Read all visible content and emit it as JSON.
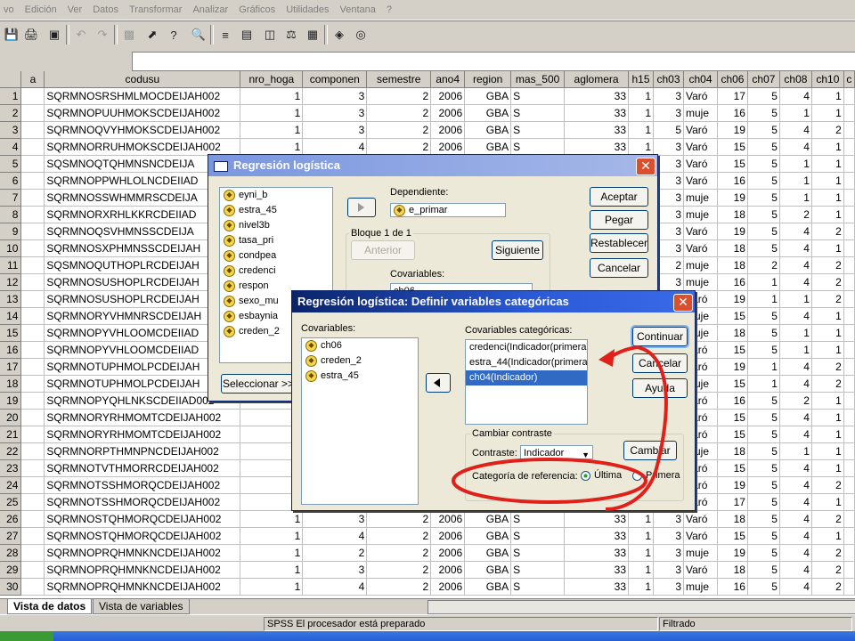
{
  "menu": [
    "vo",
    "Edición",
    "Ver",
    "Datos",
    "Transformar",
    "Analizar",
    "Gráficos",
    "Utilidades",
    "Ventana",
    "?"
  ],
  "toolbar_icons": [
    "save-icon",
    "print-icon",
    "dialog-recall-icon",
    "undo-icon",
    "redo-icon",
    "goto-chart-icon",
    "goto-case-icon",
    "variables-icon",
    "find-icon",
    "insert-cases-icon",
    "insert-variable-icon",
    "split-file-icon",
    "weight-cases-icon",
    "select-cases-icon",
    "value-labels-icon",
    "use-sets-icon"
  ],
  "grid": {
    "columns": [
      "",
      "a",
      "codusu",
      "nro_hoga",
      "componen",
      "semestre",
      "ano4",
      "region",
      "mas_500",
      "aglomera",
      "h15",
      "ch03",
      "ch04",
      "ch06",
      "ch07",
      "ch08",
      "ch10",
      "c"
    ],
    "rows": [
      [
        "1",
        "",
        "SQRMNOSRSHMLMOCDEIJAH002",
        "1",
        "3",
        "2",
        "2006",
        "GBA",
        "S",
        "33",
        "1",
        "3",
        "Varó",
        "17",
        "5",
        "4",
        "1"
      ],
      [
        "2",
        "",
        "SQRMNOPUUHMOKSCDEIJAH002",
        "1",
        "3",
        "2",
        "2006",
        "GBA",
        "S",
        "33",
        "1",
        "3",
        "muje",
        "16",
        "5",
        "1",
        "1"
      ],
      [
        "3",
        "",
        "SQRMNOQVYHMOKSCDEIJAH002",
        "1",
        "3",
        "2",
        "2006",
        "GBA",
        "S",
        "33",
        "1",
        "5",
        "Varó",
        "19",
        "5",
        "4",
        "2"
      ],
      [
        "4",
        "",
        "SQRMNORRUHMOKSCDEIJAH002",
        "1",
        "4",
        "2",
        "2006",
        "GBA",
        "S",
        "33",
        "1",
        "3",
        "Varó",
        "15",
        "5",
        "4",
        "1"
      ],
      [
        "5",
        "",
        "SQSMNOQTQHMNSNCDEIJA",
        "",
        "",
        "",
        "",
        "",
        "",
        "",
        "",
        "3",
        "Varó",
        "15",
        "5",
        "1",
        "1"
      ],
      [
        "6",
        "",
        "SQRMNOPPWHLOLNCDEIIAD",
        "",
        "",
        "",
        "",
        "",
        "",
        "",
        "",
        "3",
        "Varó",
        "16",
        "5",
        "1",
        "1"
      ],
      [
        "7",
        "",
        "SQRMNOSSWHMMRSCDEIJA",
        "",
        "",
        "",
        "",
        "",
        "",
        "",
        "",
        "3",
        "muje",
        "19",
        "5",
        "1",
        "1"
      ],
      [
        "8",
        "",
        "SQRMNORXRHLKKRCDEIIAD",
        "",
        "",
        "",
        "",
        "",
        "",
        "",
        "",
        "3",
        "muje",
        "18",
        "5",
        "2",
        "1"
      ],
      [
        "9",
        "",
        "SQRMNOQSVHMNSSCDEIJA",
        "",
        "",
        "",
        "",
        "",
        "",
        "",
        "",
        "3",
        "Varó",
        "19",
        "5",
        "4",
        "2"
      ],
      [
        "10",
        "",
        "SQRMNOSXPHMNSSCDEIJAH",
        "",
        "",
        "",
        "",
        "",
        "",
        "",
        "",
        "3",
        "Varó",
        "18",
        "5",
        "4",
        "1"
      ],
      [
        "11",
        "",
        "SQSMNOQUTHOPLRCDEIJAH",
        "",
        "",
        "",
        "",
        "",
        "",
        "",
        "",
        "2",
        "muje",
        "18",
        "2",
        "4",
        "2"
      ],
      [
        "12",
        "",
        "SQRMNOSUSHOPLRCDEIJAH",
        "",
        "",
        "",
        "",
        "",
        "",
        "",
        "",
        "3",
        "muje",
        "16",
        "1",
        "4",
        "2"
      ],
      [
        "13",
        "",
        "SQRMNOSUSHOPLRCDEIJAH",
        "",
        "",
        "",
        "",
        "",
        "",
        "",
        "",
        "3",
        "Varó",
        "19",
        "1",
        "1",
        "2"
      ],
      [
        "14",
        "",
        "SQRMNORYVHMNRSCDEIJAH",
        "",
        "",
        "",
        "",
        "",
        "",
        "",
        "",
        "",
        "muje",
        "15",
        "5",
        "4",
        "1"
      ],
      [
        "15",
        "",
        "SQRMNOPYVHLOOMCDEIIAD",
        "",
        "",
        "",
        "",
        "",
        "",
        "",
        "",
        "",
        "muje",
        "18",
        "5",
        "1",
        "1"
      ],
      [
        "16",
        "",
        "SQRMNOPYVHLOOMCDEIIAD",
        "",
        "",
        "",
        "",
        "",
        "",
        "",
        "",
        "",
        "Varó",
        "15",
        "5",
        "1",
        "1"
      ],
      [
        "17",
        "",
        "SQRMNOTUPHMOLPCDEIJAH",
        "",
        "",
        "",
        "",
        "",
        "",
        "",
        "",
        "",
        "Varó",
        "19",
        "1",
        "4",
        "2"
      ],
      [
        "18",
        "",
        "SQRMNOTUPHMOLPCDEIJAH",
        "",
        "",
        "",
        "",
        "",
        "",
        "",
        "",
        "",
        "muje",
        "15",
        "1",
        "4",
        "2"
      ],
      [
        "19",
        "",
        "SQRMNOPYQHLNKSCDEIIAD002",
        "",
        "",
        "",
        "",
        "",
        "",
        "",
        "",
        "",
        "Varó",
        "16",
        "5",
        "2",
        "1"
      ],
      [
        "20",
        "",
        "SQRMNORYRHMOMTCDEIJAH002",
        "",
        "",
        "",
        "",
        "",
        "",
        "",
        "",
        "",
        "Varó",
        "15",
        "5",
        "4",
        "1"
      ],
      [
        "21",
        "",
        "SQRMNORYRHMOMTCDEIJAH002",
        "",
        "",
        "",
        "",
        "",
        "",
        "",
        "",
        "",
        "Varó",
        "15",
        "5",
        "4",
        "1"
      ],
      [
        "22",
        "",
        "SQRMNORPTHMNPNCDEIJAH002",
        "",
        "",
        "",
        "",
        "",
        "",
        "",
        "",
        "",
        "muje",
        "18",
        "5",
        "1",
        "1"
      ],
      [
        "23",
        "",
        "SQRMNOTVTHMORRCDEIJAH002",
        "",
        "",
        "",
        "",
        "",
        "",
        "",
        "",
        "",
        "Varó",
        "15",
        "5",
        "4",
        "1"
      ],
      [
        "24",
        "",
        "SQRMNOTSSHMORQCDEIJAH002",
        "",
        "",
        "",
        "",
        "",
        "",
        "",
        "",
        "",
        "Varó",
        "19",
        "5",
        "4",
        "2"
      ],
      [
        "25",
        "",
        "SQRMNOTSSHMORQCDEIJAH002",
        "",
        "",
        "",
        "",
        "",
        "",
        "",
        "",
        "",
        "Varó",
        "17",
        "5",
        "4",
        "1"
      ],
      [
        "26",
        "",
        "SQRMNOSTQHMORQCDEIJAH002",
        "1",
        "3",
        "2",
        "2006",
        "GBA",
        "S",
        "33",
        "1",
        "3",
        "Varó",
        "18",
        "5",
        "4",
        "2"
      ],
      [
        "27",
        "",
        "SQRMNOSTQHMORQCDEIJAH002",
        "1",
        "4",
        "2",
        "2006",
        "GBA",
        "S",
        "33",
        "1",
        "3",
        "Varó",
        "15",
        "5",
        "4",
        "1"
      ],
      [
        "28",
        "",
        "SQRMNOPRQHMNKNCDEIJAH002",
        "1",
        "2",
        "2",
        "2006",
        "GBA",
        "S",
        "33",
        "1",
        "3",
        "muje",
        "19",
        "5",
        "4",
        "2"
      ],
      [
        "29",
        "",
        "SQRMNOPRQHMNKNCDEIJAH002",
        "1",
        "3",
        "2",
        "2006",
        "GBA",
        "S",
        "33",
        "1",
        "3",
        "Varó",
        "18",
        "5",
        "4",
        "2"
      ],
      [
        "30",
        "",
        "SQRMNOPRQHMNKNCDEIJAH002",
        "1",
        "4",
        "2",
        "2006",
        "GBA",
        "S",
        "33",
        "1",
        "3",
        "muje",
        "16",
        "5",
        "4",
        "2"
      ]
    ]
  },
  "tabs": {
    "data_view": "Vista de datos",
    "variable_view": "Vista de variables"
  },
  "status": {
    "processor": "SPSS El procesador  está preparado",
    "filter": "Filtrado"
  },
  "dialog1": {
    "title": "Regresión logística",
    "vars": [
      "eyni_b",
      "estra_45",
      "nivel3b",
      "tasa_pri",
      "condpea",
      "credenci",
      "respon",
      "sexo_mu",
      "esbaynia",
      "creden_2"
    ],
    "dependent_label": "Dependiente:",
    "dependent_value": "e_primar",
    "block_label": "Bloque 1 de 1",
    "prev": "Anterior",
    "next": "Siguiente",
    "covariates_label": "Covariables:",
    "covariate_partial": "ch06",
    "select_btn": "Seleccionar >>",
    "buttons": [
      "Aceptar",
      "Pegar",
      "Restablecer",
      "Cancelar"
    ]
  },
  "dialog2": {
    "title": "Regresión logística: Definir variables categóricas",
    "covariates_label": "Covariables:",
    "covariates": [
      "ch06",
      "creden_2",
      "estra_45"
    ],
    "categorical_label": "Covariables categóricas:",
    "categorical": [
      "credenci(Indicador(primera))",
      "estra_44(Indicador(primera))",
      "ch04(Indicador)"
    ],
    "buttons": {
      "continue": "Continuar",
      "cancel": "Cancelar",
      "help": "Ayuda",
      "change": "Cambiar"
    },
    "contrast_group": "Cambiar contraste",
    "contrast_label": "Contraste:",
    "contrast_value": "Indicador",
    "ref_label": "Categoría de referencia:",
    "ref_last": "Última",
    "ref_first": "Primera"
  },
  "annotation_color": "#e0201a"
}
